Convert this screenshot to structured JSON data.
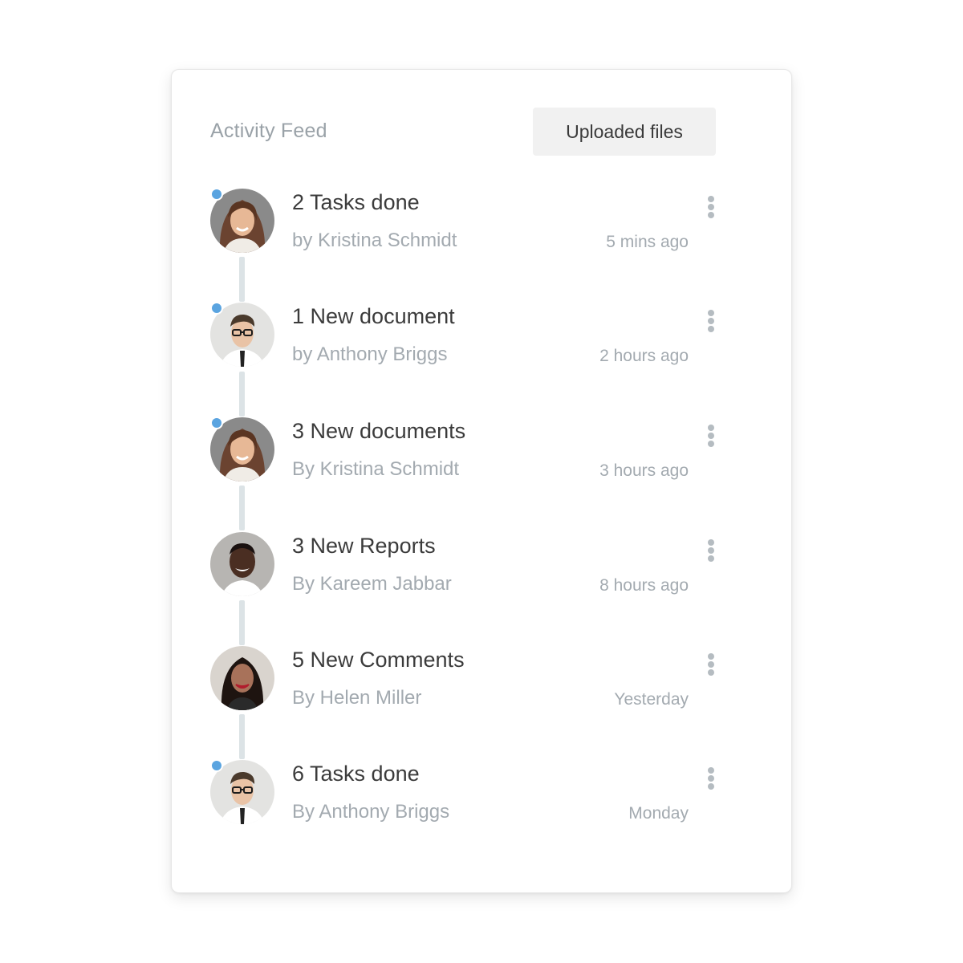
{
  "feed": {
    "title": "Activity Feed",
    "button_label": "Uploaded files"
  },
  "colors": {
    "online_dot": "#5aa4e0",
    "timeline": "#dce3e6",
    "button_bg": "#f1f1f1"
  },
  "items": [
    {
      "title": "2 Tasks done",
      "subtitle": "by Kristina Schmidt",
      "time": "5 mins ago",
      "online": true,
      "avatar": "kristina"
    },
    {
      "title": "1 New document",
      "subtitle": "by Anthony Briggs",
      "time": "2 hours ago",
      "online": true,
      "avatar": "anthony"
    },
    {
      "title": "3 New documents",
      "subtitle": "By Kristina Schmidt",
      "time": "3 hours ago",
      "online": true,
      "avatar": "kristina"
    },
    {
      "title": "3 New Reports",
      "subtitle": "By Kareem Jabbar",
      "time": "8 hours ago",
      "online": false,
      "avatar": "kareem"
    },
    {
      "title": "5 New Comments",
      "subtitle": "By Helen Miller",
      "time": "Yesterday",
      "online": false,
      "avatar": "helen"
    },
    {
      "title": "6 Tasks done",
      "subtitle": "By Anthony Briggs",
      "time": "Monday",
      "online": true,
      "avatar": "anthony"
    }
  ]
}
